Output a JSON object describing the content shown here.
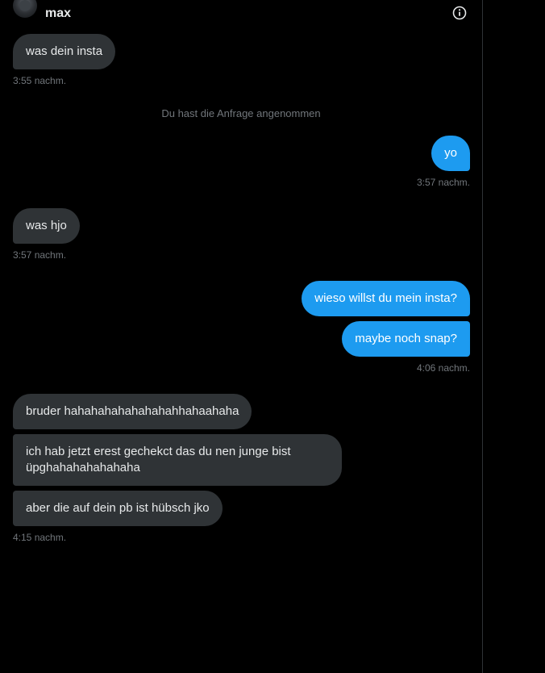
{
  "header": {
    "name": "max",
    "info_icon": "info-icon"
  },
  "colors": {
    "incoming_bubble": "#2f3336",
    "outgoing_bubble": "#1d9bf0",
    "timestamp": "#71767b",
    "background": "#000000"
  },
  "messages": {
    "m1": "was dein insta",
    "t1": "3:55 nachm.",
    "system": "Du hast die Anfrage angenommen",
    "m2": "yo",
    "t2": "3:57 nachm.",
    "m3": "was hjo",
    "t3": "3:57 nachm.",
    "m4": "wieso willst du mein insta?",
    "m5": "maybe noch snap?",
    "t5": "4:06 nachm.",
    "m6": "bruder hahahahahahahahahhahaahaha",
    "m7_line1": "ich hab jetzt erest gechekct das du nen junge bist",
    "m7_line2": "üpghahahahahahaha",
    "m8": "aber die auf dein pb ist hübsch jko",
    "t8": "4:15 nachm."
  }
}
